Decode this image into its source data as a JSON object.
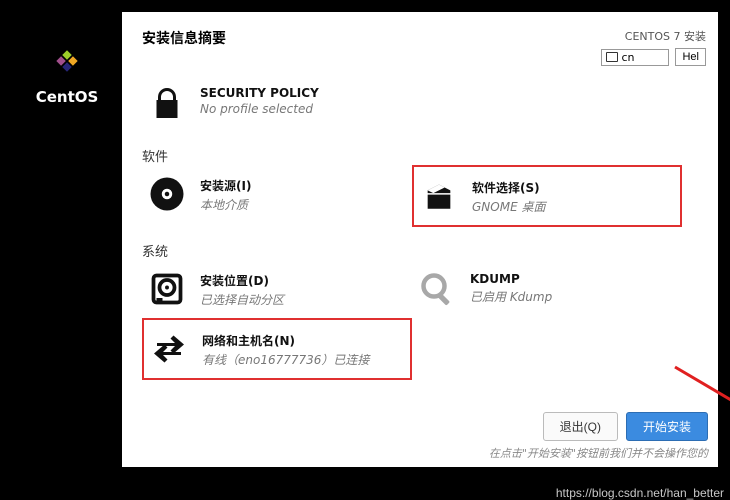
{
  "sidebar": {
    "product_name": "CentOS"
  },
  "header": {
    "title": "安装信息摘要",
    "installer_name": "CENTOS 7 安装",
    "language_code": "cn",
    "help_label": "Hel"
  },
  "localization": {
    "security_policy": {
      "title": "SECURITY POLICY",
      "subtitle": "No profile selected"
    }
  },
  "software": {
    "label": "软件",
    "source": {
      "title": "安装源(I)",
      "subtitle": "本地介质"
    },
    "selection": {
      "title": "软件选择(S)",
      "subtitle": "GNOME 桌面"
    }
  },
  "system": {
    "label": "系统",
    "destination": {
      "title": "安装位置(D)",
      "subtitle": "已选择自动分区"
    },
    "kdump": {
      "title": "KDUMP",
      "subtitle": "已启用 Kdump"
    },
    "network": {
      "title": "网络和主机名(N)",
      "subtitle": "有线（eno16777736）已连接"
    }
  },
  "footer": {
    "quit": "退出(Q)",
    "begin": "开始安装",
    "hint": "在点击\"开始安装\"按钮前我们并不会操作您的"
  },
  "watermark": "https://blog.csdn.net/han_better"
}
